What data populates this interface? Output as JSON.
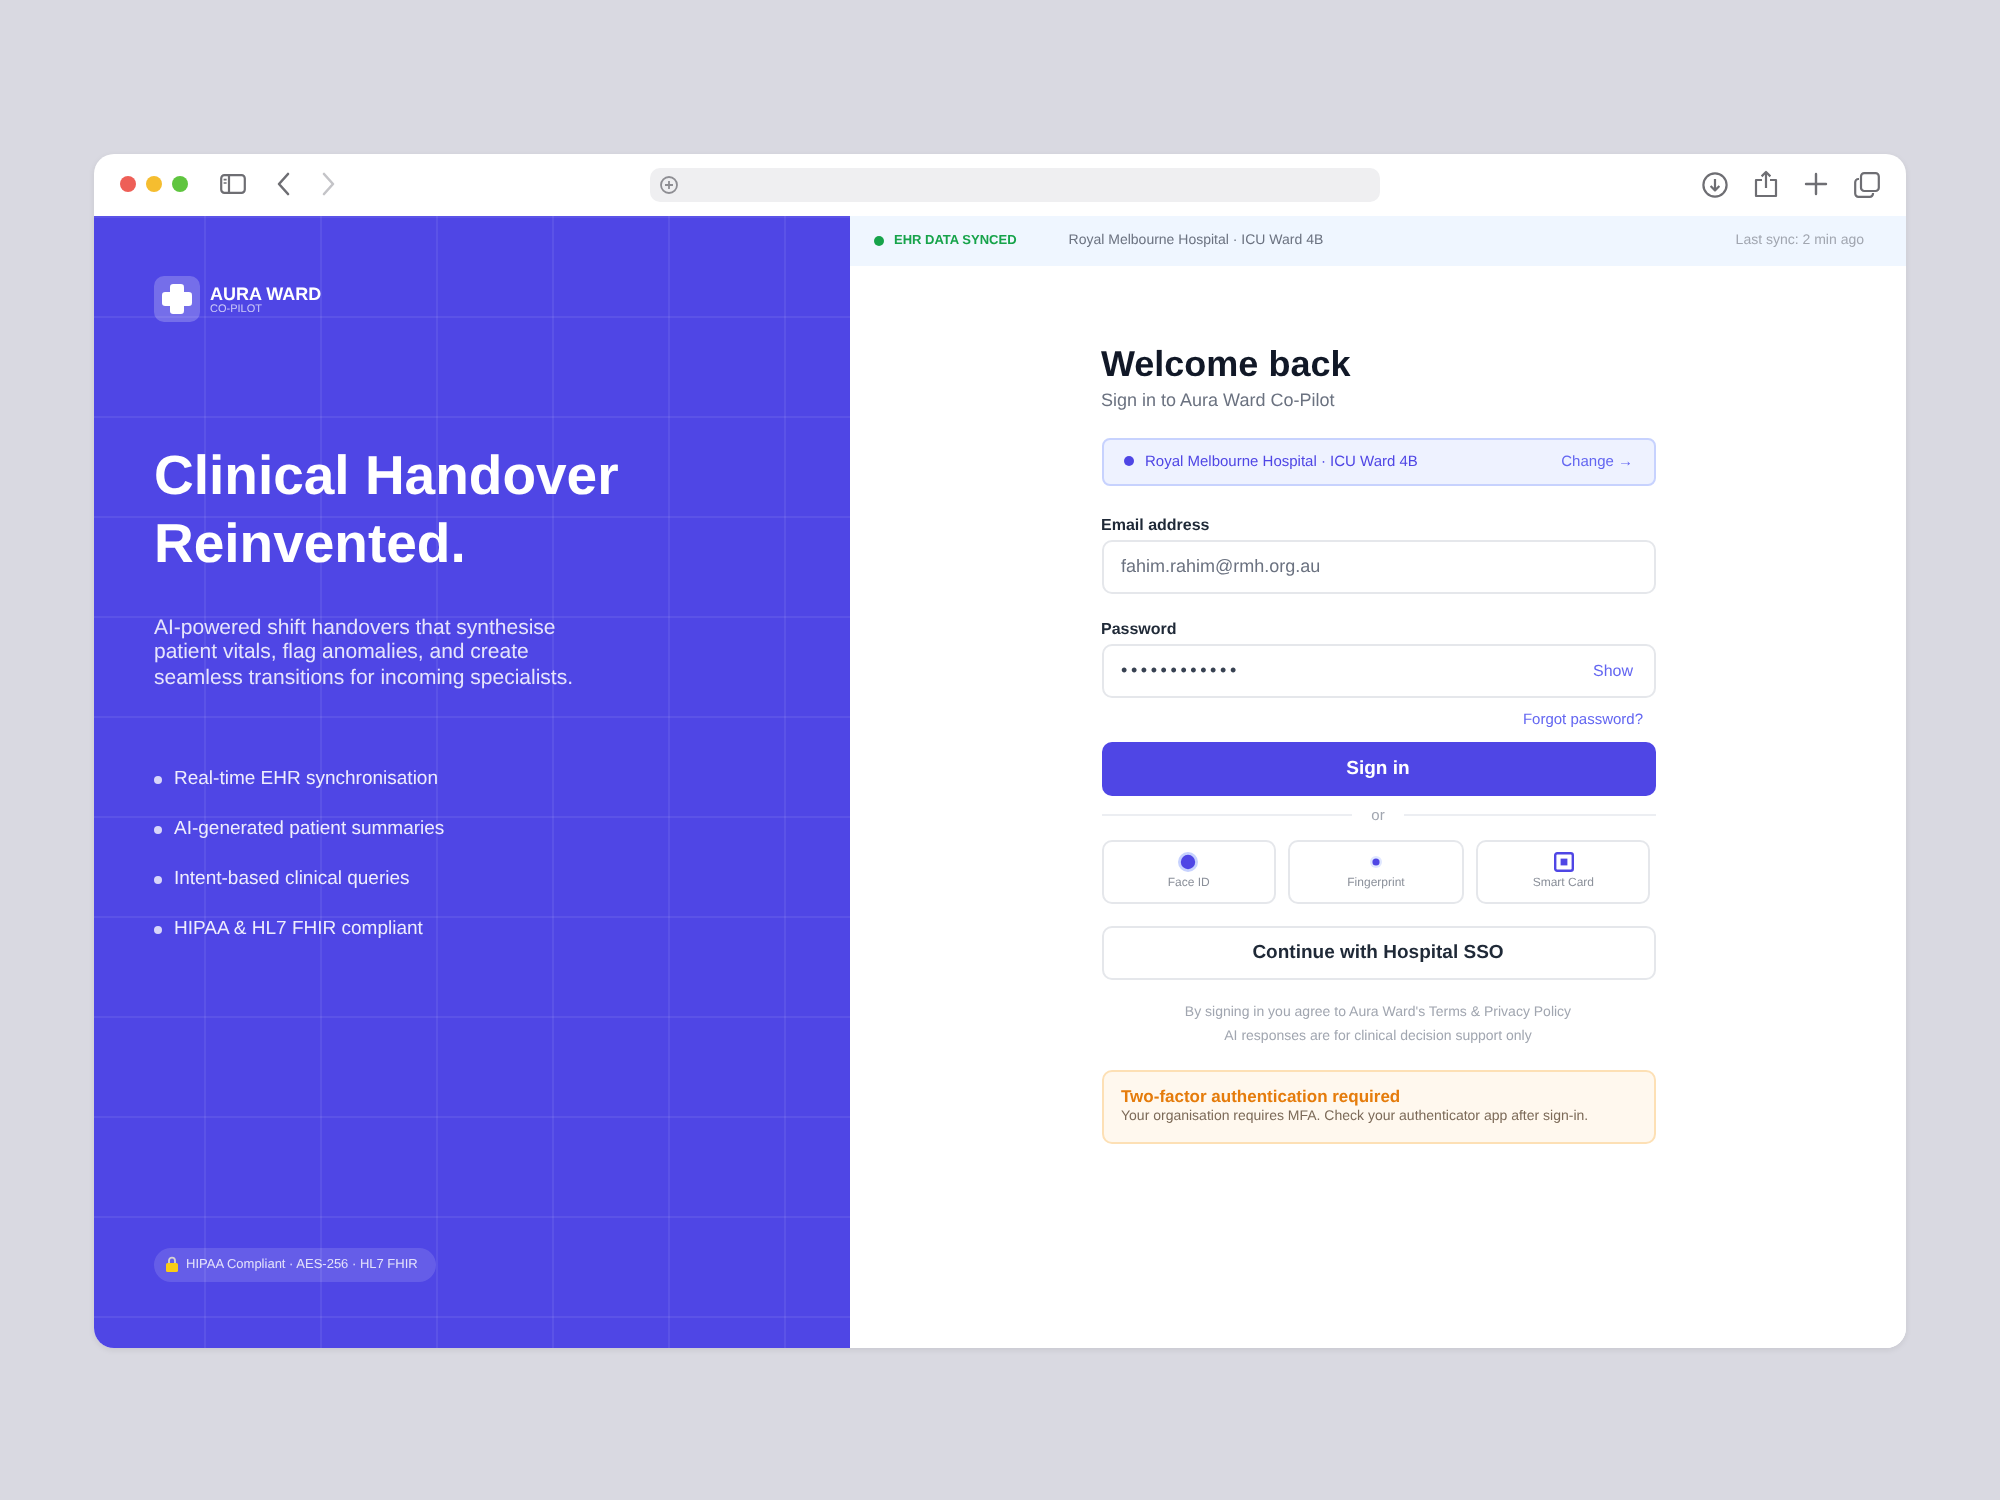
{
  "browser": {
    "nav": [
      {
        "kind": "back",
        "disabled": false
      },
      {
        "kind": "forward",
        "disabled": true
      }
    ]
  },
  "brand": {
    "name": "AURA WARD",
    "tagline": "CO-PILOT"
  },
  "hero": {
    "headline": "Clinical Handover Reinvented.",
    "description": "AI-powered shift handovers that synthesise patient vitals, flag anomalies, and create seamless transitions for incoming specialists."
  },
  "features": [
    "Real-time EHR synchronisation",
    "AI-generated patient summaries",
    "Intent-based clinical queries",
    "HIPAA & HL7 FHIR compliant"
  ],
  "compliance_badge": "HIPAA Compliant · AES-256 · HL7 FHIR",
  "status_bar": {
    "status": "EHR DATA SYNCED",
    "location": "Royal Melbourne Hospital · ICU Ward 4B",
    "last_sync": "Last sync: 2 min ago"
  },
  "sign_in": {
    "title": "Welcome back",
    "subtitle": "Sign in to Aura Ward Co-Pilot",
    "hospital": {
      "label": "Royal Melbourne Hospital · ICU Ward 4B",
      "action": "Change →"
    },
    "fields": [
      {
        "kind": "email",
        "label": "Email address",
        "value": "fahim.rahim@rmh.org.au"
      },
      {
        "kind": "password",
        "label": "Password",
        "value": "••••••••••••",
        "action": "Show"
      }
    ],
    "forgot_link": "Forgot password?",
    "submit": "Sign in",
    "divider": "or",
    "methods": [
      {
        "kind": "face",
        "label": "Face ID"
      },
      {
        "kind": "fingerprint",
        "label": "Fingerprint"
      },
      {
        "kind": "card",
        "label": "Smart Card"
      }
    ],
    "sso": "Continue with Hospital SSO",
    "legal": [
      "By signing in you agree to Aura Ward's Terms & Privacy Policy",
      "AI responses are for clinical decision support only"
    ],
    "alert": {
      "title": "Two-factor authentication required",
      "message": "Your organisation requires MFA. Check your authenticator app after sign-in."
    }
  }
}
